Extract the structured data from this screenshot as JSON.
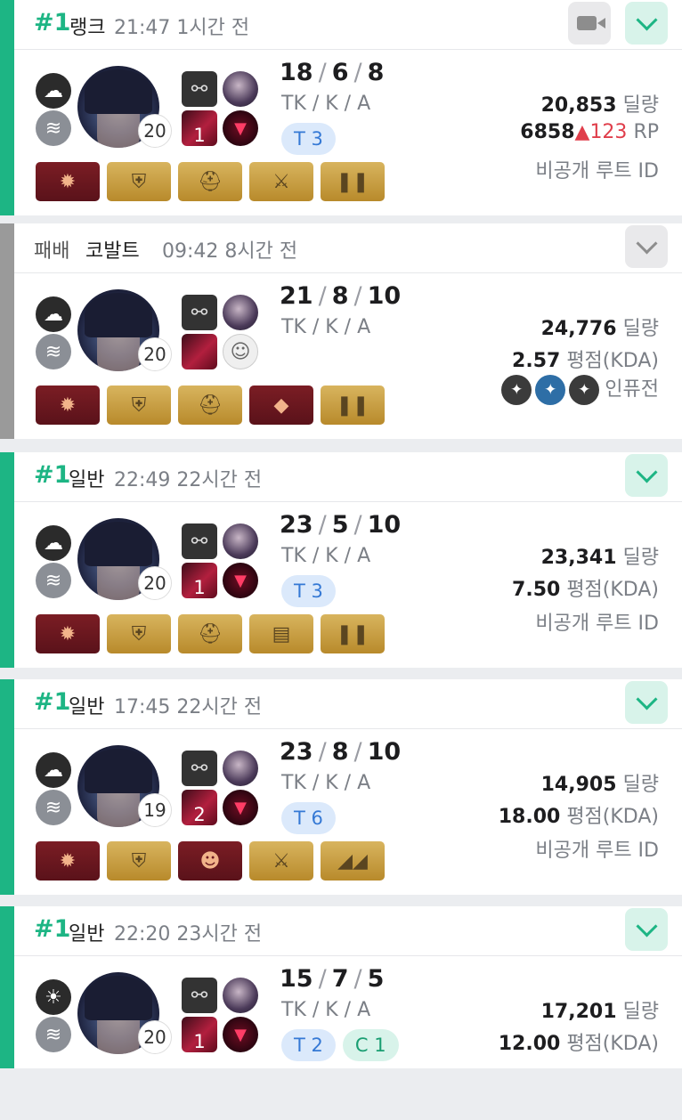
{
  "games": [
    {
      "rank": "#1",
      "mode": "랭크",
      "time": "21:47",
      "ago": "1시간 전",
      "kills": "18",
      "deaths": "6",
      "assists": "8",
      "kda_label": "TK / K / A",
      "level": "20",
      "skill_level": "1",
      "tags": [
        {
          "text": "T 3",
          "kind": "t"
        }
      ],
      "damage": "20,853",
      "damage_unit": "딜량",
      "stat_num": "6858",
      "stat_delta_icon": "▲",
      "stat_delta": "123",
      "stat_unit": "RP",
      "extra": "비공개 루트 ID",
      "weather": [
        "cloud-icon",
        "wind-icon"
      ],
      "items": [
        {
          "icon": "gauntlet-icon",
          "tier": "red"
        },
        {
          "icon": "armor-icon",
          "tier": "gold"
        },
        {
          "icon": "helmet-icon",
          "tier": "gold"
        },
        {
          "icon": "claw-icon",
          "tier": "gold"
        },
        {
          "icon": "boots-icon",
          "tier": "gold"
        }
      ]
    },
    {
      "rank": "패배",
      "mode": "코발트",
      "time": "09:42",
      "ago": "8시간 전",
      "kills": "21",
      "deaths": "8",
      "assists": "10",
      "kda_label": "TK / K / A",
      "level": "20",
      "skill_level": "",
      "tags": [],
      "damage": "24,776",
      "damage_unit": "딜량",
      "stat_num": "2.57",
      "stat_unit": "평점(KDA)",
      "extra": "인퓨전",
      "weather": [
        "cloud-icon",
        "wind-icon"
      ],
      "items": [
        {
          "icon": "gauntlet-icon",
          "tier": "red"
        },
        {
          "icon": "armor-icon",
          "tier": "gold"
        },
        {
          "icon": "helmet-icon",
          "tier": "gold"
        },
        {
          "icon": "meat-icon",
          "tier": "red"
        },
        {
          "icon": "boots-icon",
          "tier": "gold"
        }
      ]
    },
    {
      "rank": "#1",
      "mode": "일반",
      "time": "22:49",
      "ago": "22시간 전",
      "kills": "23",
      "deaths": "5",
      "assists": "10",
      "kda_label": "TK / K / A",
      "level": "20",
      "skill_level": "1",
      "tags": [
        {
          "text": "T 3",
          "kind": "t"
        }
      ],
      "damage": "23,341",
      "damage_unit": "딜량",
      "stat_num": "7.50",
      "stat_unit": "평점(KDA)",
      "extra": "비공개 루트 ID",
      "weather": [
        "cloud-icon",
        "wind-icon"
      ],
      "items": [
        {
          "icon": "gauntlet-icon",
          "tier": "red"
        },
        {
          "icon": "armor-icon",
          "tier": "gold"
        },
        {
          "icon": "helmet-icon",
          "tier": "gold"
        },
        {
          "icon": "scroll-icon",
          "tier": "gold"
        },
        {
          "icon": "boots-icon",
          "tier": "gold"
        }
      ]
    },
    {
      "rank": "#1",
      "mode": "일반",
      "time": "17:45",
      "ago": "22시간 전",
      "kills": "23",
      "deaths": "8",
      "assists": "10",
      "kda_label": "TK / K / A",
      "level": "19",
      "skill_level": "2",
      "tags": [
        {
          "text": "T 6",
          "kind": "t"
        }
      ],
      "damage": "14,905",
      "damage_unit": "딜량",
      "stat_num": "18.00",
      "stat_unit": "평점(KDA)",
      "extra": "비공개 루트 ID",
      "weather": [
        "cloud-icon",
        "wind-icon"
      ],
      "items": [
        {
          "icon": "gauntlet-icon",
          "tier": "red"
        },
        {
          "icon": "armor-icon",
          "tier": "gold"
        },
        {
          "icon": "mask-icon",
          "tier": "red"
        },
        {
          "icon": "claw-icon",
          "tier": "gold"
        },
        {
          "icon": "heels-icon",
          "tier": "gold"
        }
      ]
    },
    {
      "rank": "#1",
      "mode": "일반",
      "time": "22:20",
      "ago": "23시간 전",
      "kills": "15",
      "deaths": "7",
      "assists": "5",
      "kda_label": "TK / K / A",
      "level": "20",
      "skill_level": "1",
      "tags": [
        {
          "text": "T 2",
          "kind": "t"
        },
        {
          "text": "C 1",
          "kind": "c"
        }
      ],
      "damage": "17,201",
      "damage_unit": "딜량",
      "stat_num": "12.00",
      "stat_unit": "평점(KDA)",
      "extra": "",
      "weather": [
        "sun-icon",
        "wind-icon"
      ],
      "items": []
    }
  ]
}
